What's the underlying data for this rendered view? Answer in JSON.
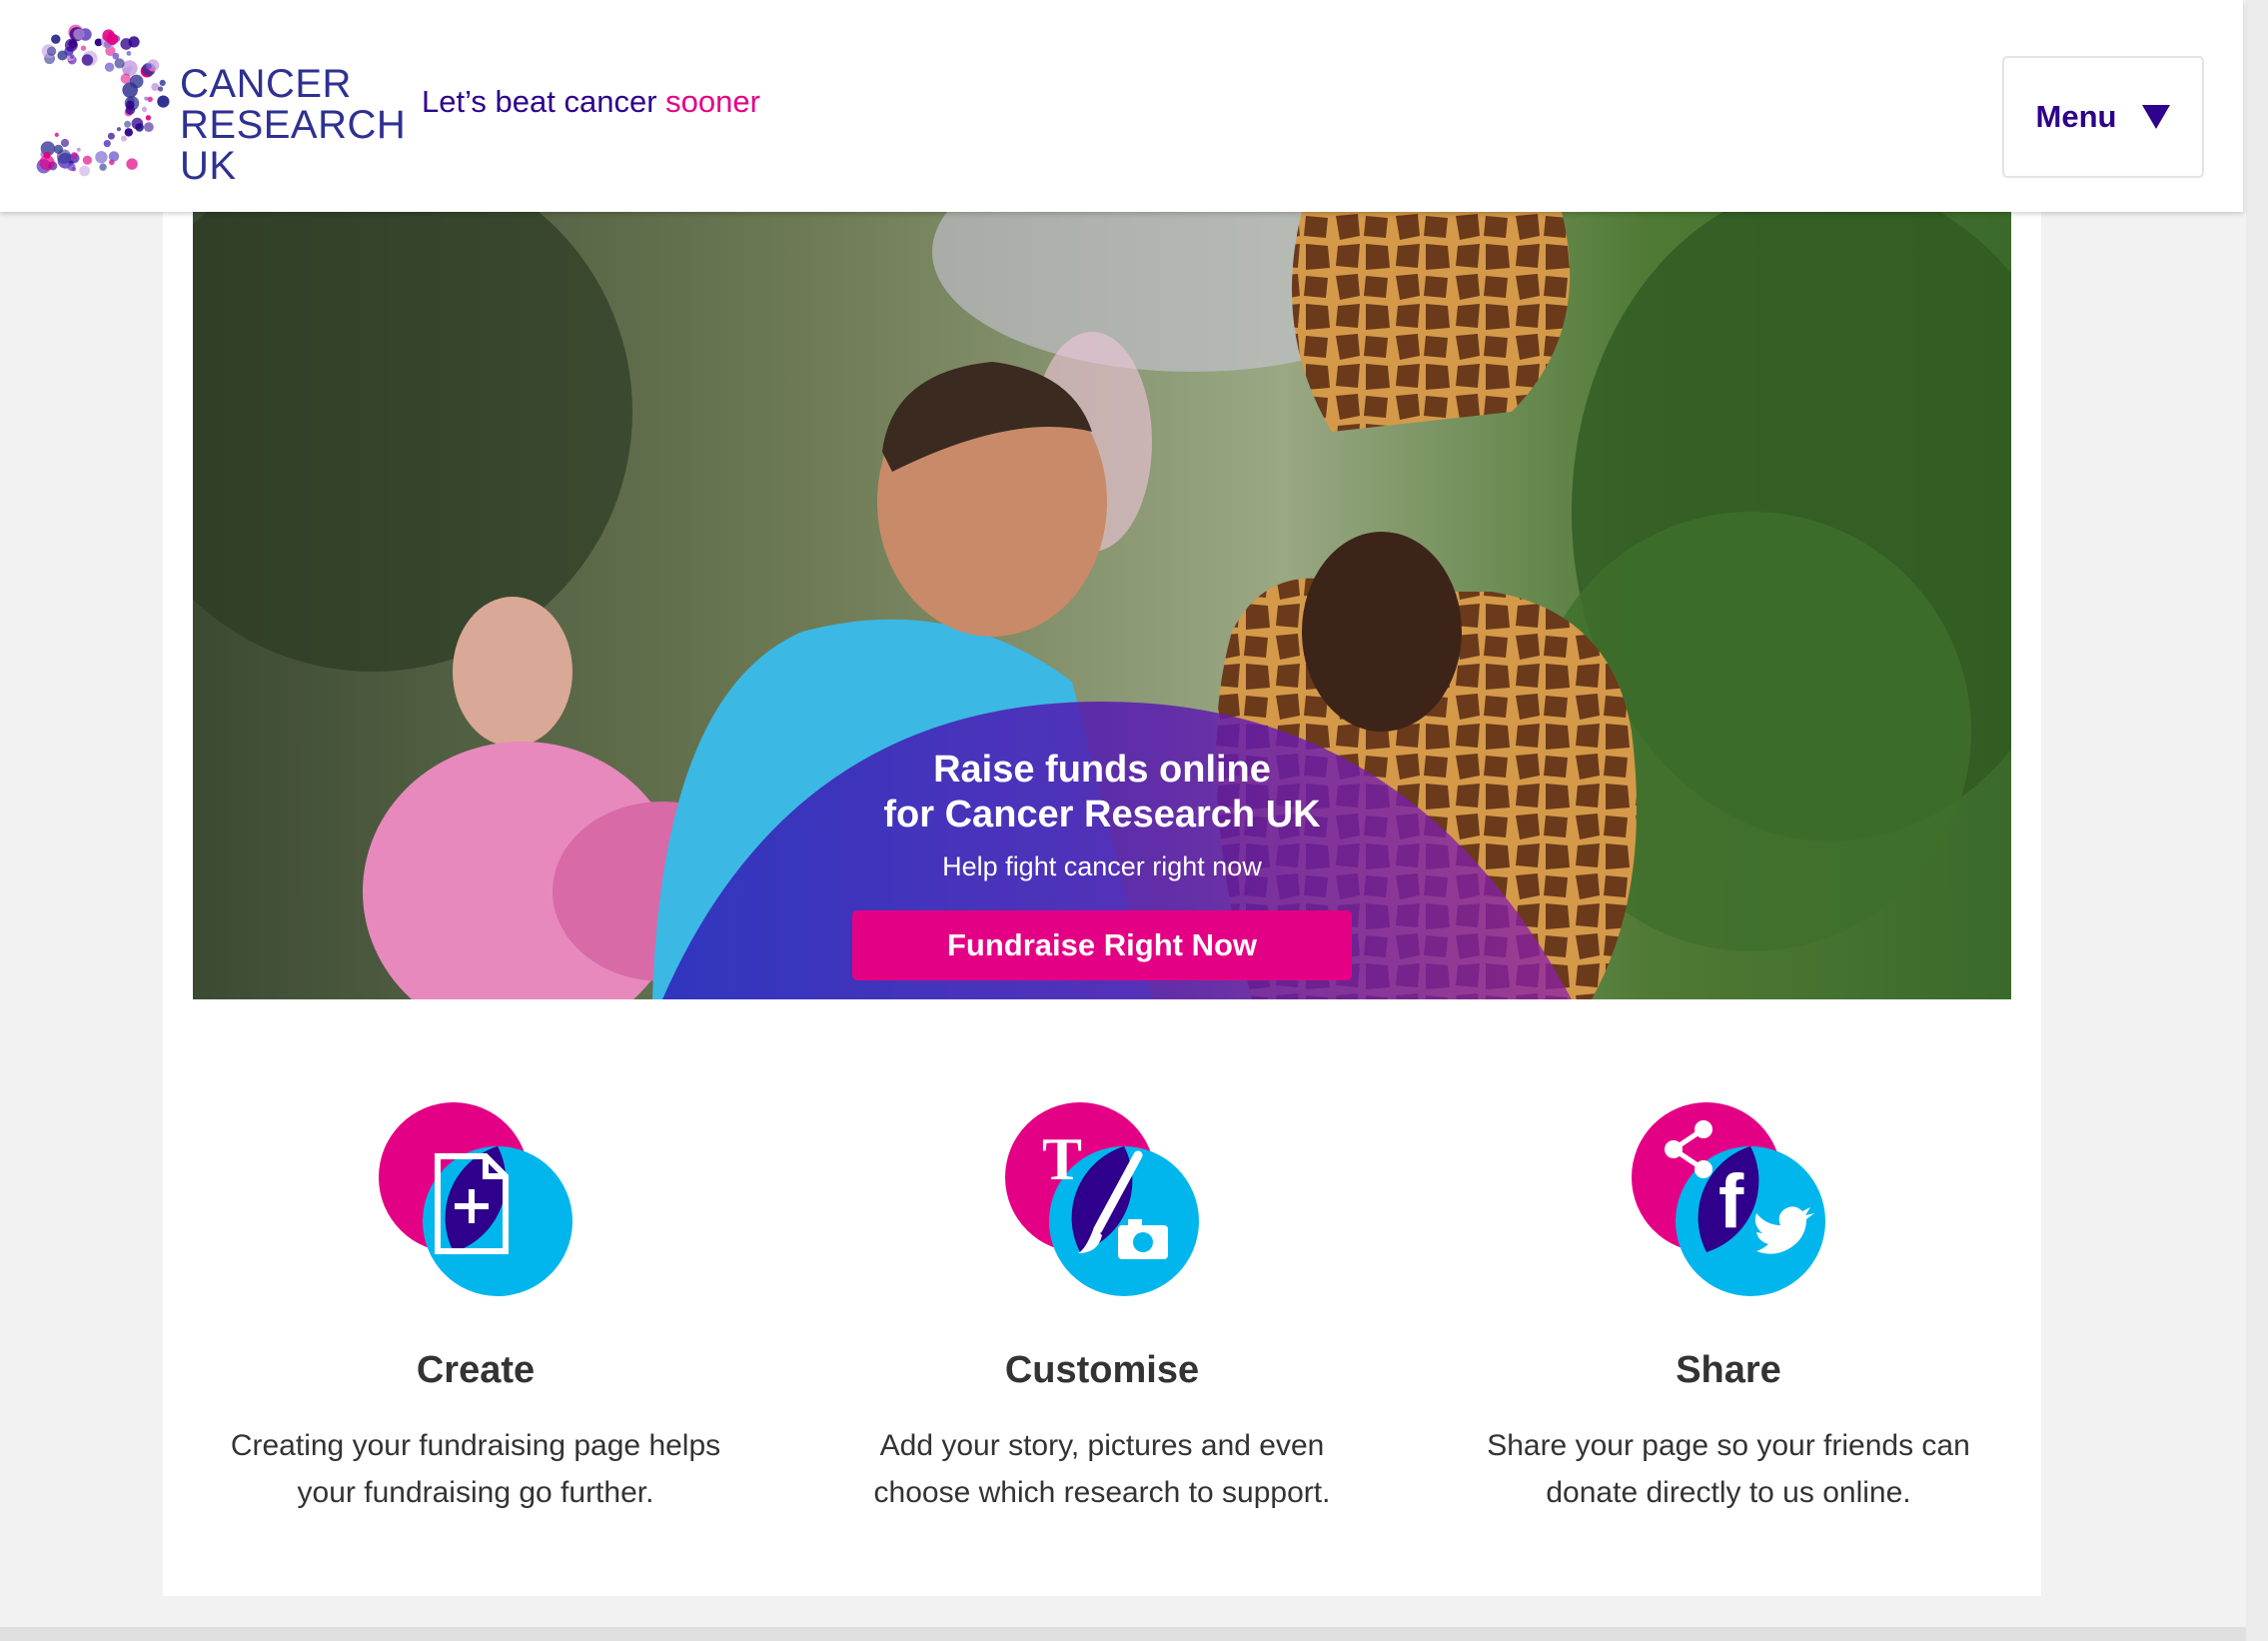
{
  "header": {
    "logo_lines": [
      "CANCER",
      "RESEARCH",
      "UK"
    ],
    "tagline_main": "Let’s beat cancer ",
    "tagline_accent": "sooner",
    "menu_label": "Menu"
  },
  "hero": {
    "title_line1": "Raise funds online",
    "title_line2": "for Cancer Research UK",
    "subtitle": "Help fight cancer right now",
    "button_label": "Fundraise Right Now"
  },
  "features": [
    {
      "icon": "create-page-icon",
      "title": "Create",
      "desc_line1": "Creating your fundraising page helps",
      "desc_line2": "your fundraising go further."
    },
    {
      "icon": "customise-icon",
      "title": "Customise",
      "desc_line1": "Add your story, pictures and even",
      "desc_line2": "choose which research to support."
    },
    {
      "icon": "share-icon",
      "title": "Share",
      "desc_line1": "Share your page so your friends can",
      "desc_line2": "donate directly to us online."
    }
  ],
  "colors": {
    "brand_navy": "#2e008b",
    "brand_pink": "#e40085",
    "brand_cyan": "#00b6ed",
    "logo_blue": "#2e3191"
  }
}
